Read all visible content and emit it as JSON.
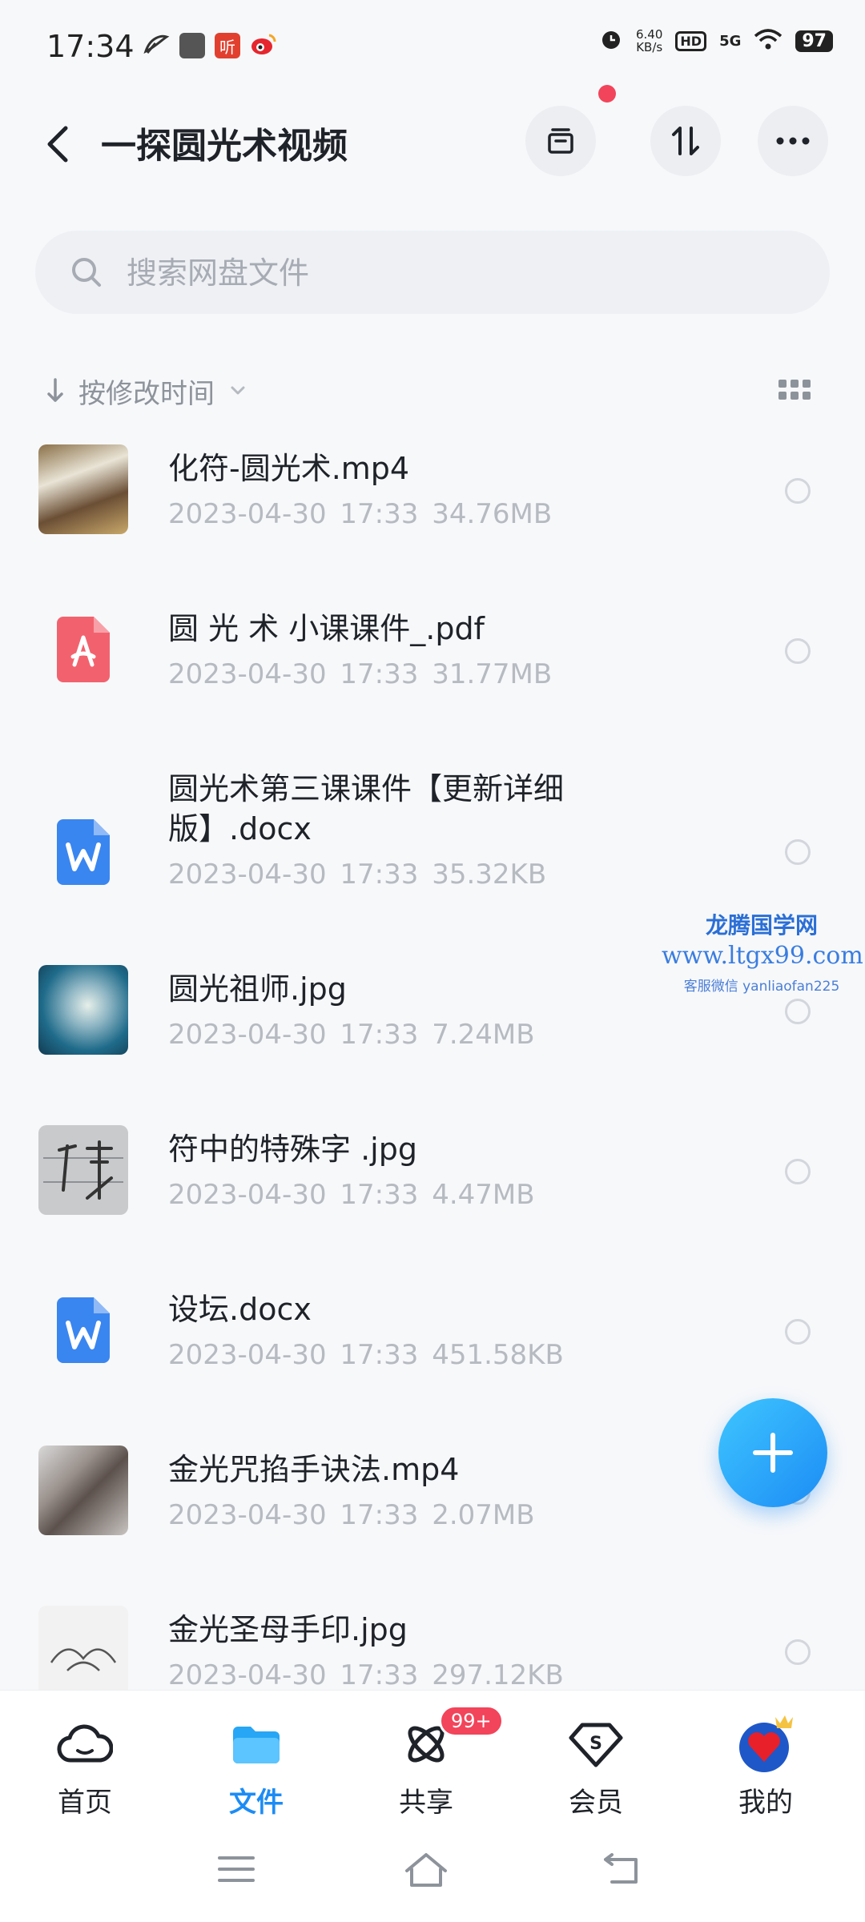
{
  "status_bar": {
    "time": "17:34",
    "app_icons": [
      "feather-icon",
      "square-app-icon",
      "ting-app-icon",
      "weibo-icon"
    ],
    "ting_label": "听",
    "net_speed_value": "6.40",
    "net_speed_unit": "KB/s",
    "hd_label": "HD",
    "signal_label": "5G",
    "battery": "97"
  },
  "header": {
    "title": "一探圆光术视频"
  },
  "search": {
    "placeholder": "搜索网盘文件"
  },
  "sort": {
    "label": "按修改时间"
  },
  "files": [
    {
      "name": "化符-圆光术.mp4",
      "meta": "2023-04-30  17:33  34.76MB",
      "type": "video"
    },
    {
      "name": "圆 光 术 小课课件_.pdf",
      "meta": "2023-04-30  17:33  31.77MB",
      "type": "pdf"
    },
    {
      "name": "圆光术第三课课件【更新详细版】.docx",
      "meta": "2023-04-30  17:33  35.32KB",
      "type": "doc"
    },
    {
      "name": "圆光祖师.jpg",
      "meta": "2023-04-30  17:33  7.24MB",
      "type": "image"
    },
    {
      "name": "符中的特殊字 .jpg",
      "meta": "2023-04-30  17:33  4.47MB",
      "type": "image"
    },
    {
      "name": "设坛.docx",
      "meta": "2023-04-30  17:33  451.58KB",
      "type": "doc"
    },
    {
      "name": "金光咒掐手诀法.mp4",
      "meta": "2023-04-30  17:33  2.07MB",
      "type": "video"
    },
    {
      "name": "金光圣母手印.jpg",
      "meta": "2023-04-30  17:33  297.12KB",
      "type": "image"
    }
  ],
  "watermark": {
    "title": "龙腾国学网",
    "url": "www.ltgx99.com",
    "sub": "客服微信 yanliaofan225"
  },
  "bottom_nav": {
    "items": [
      {
        "label": "首页",
        "icon": "cloud-home-icon"
      },
      {
        "label": "文件",
        "icon": "folder-icon"
      },
      {
        "label": "共享",
        "icon": "share-atom-icon"
      },
      {
        "label": "会员",
        "icon": "vip-diamond-icon"
      },
      {
        "label": "我的",
        "icon": "avatar-icon"
      }
    ],
    "share_badge": "99+"
  },
  "colors": {
    "accent": "#1c8cf5",
    "badge_red": "#f2445a",
    "pdf_red": "#f2626e",
    "doc_blue": "#3a86f0"
  }
}
